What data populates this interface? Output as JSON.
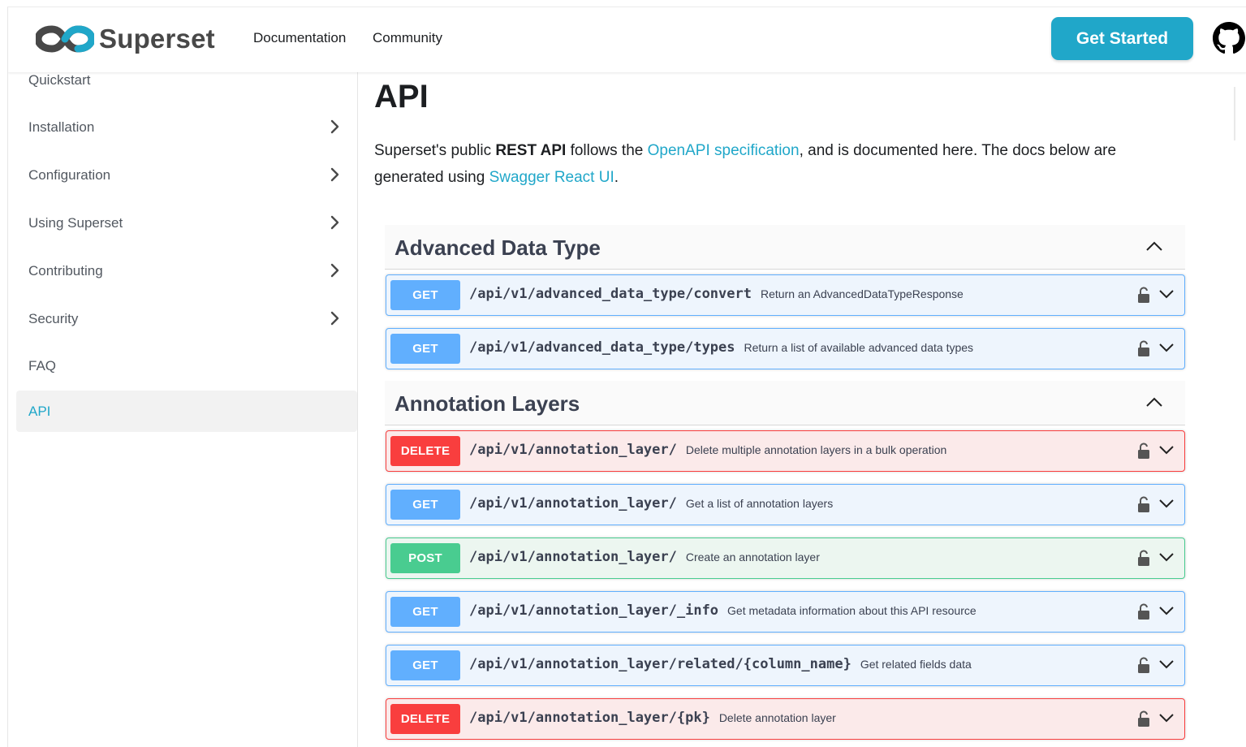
{
  "brand": {
    "name": "Superset"
  },
  "nav": {
    "links": [
      "Documentation",
      "Community"
    ],
    "cta": "Get Started",
    "github_icon": "github-icon"
  },
  "sidebar": {
    "items": [
      {
        "label": "Quickstart",
        "expandable": false,
        "active": false
      },
      {
        "label": "Installation",
        "expandable": true,
        "active": false
      },
      {
        "label": "Configuration",
        "expandable": true,
        "active": false
      },
      {
        "label": "Using Superset",
        "expandable": true,
        "active": false
      },
      {
        "label": "Contributing",
        "expandable": true,
        "active": false
      },
      {
        "label": "Security",
        "expandable": true,
        "active": false
      },
      {
        "label": "FAQ",
        "expandable": false,
        "active": false
      },
      {
        "label": "API",
        "expandable": false,
        "active": true
      }
    ]
  },
  "page": {
    "title": "API",
    "intro": {
      "t1": "Superset's public ",
      "bold": "REST API",
      "t2": " follows the ",
      "link1": "OpenAPI specification",
      "t3": ", and is documented here. The docs below are generated using ",
      "link2": "Swagger React UI",
      "t4": "."
    }
  },
  "colors": {
    "accent": "#20a7c9",
    "get": "#61affe",
    "delete": "#f93e3e",
    "post": "#49cc90"
  },
  "sections": [
    {
      "title": "Advanced Data Type",
      "ops": [
        {
          "method": "GET",
          "path": "/api/v1/advanced_data_type/convert",
          "summary": "Return an AdvancedDataTypeResponse"
        },
        {
          "method": "GET",
          "path": "/api/v1/advanced_data_type/types",
          "summary": "Return a list of available advanced data types"
        }
      ]
    },
    {
      "title": "Annotation Layers",
      "ops": [
        {
          "method": "DELETE",
          "path": "/api/v1/annotation_layer/",
          "summary": "Delete multiple annotation layers in a bulk operation"
        },
        {
          "method": "GET",
          "path": "/api/v1/annotation_layer/",
          "summary": "Get a list of annotation layers"
        },
        {
          "method": "POST",
          "path": "/api/v1/annotation_layer/",
          "summary": "Create an annotation layer"
        },
        {
          "method": "GET",
          "path": "/api/v1/annotation_layer/_info",
          "summary": "Get metadata information about this API resource"
        },
        {
          "method": "GET",
          "path": "/api/v1/annotation_layer/related/{column_name}",
          "summary": "Get related fields data"
        },
        {
          "method": "DELETE",
          "path": "/api/v1/annotation_layer/{pk}",
          "summary": "Delete annotation layer"
        }
      ]
    }
  ]
}
